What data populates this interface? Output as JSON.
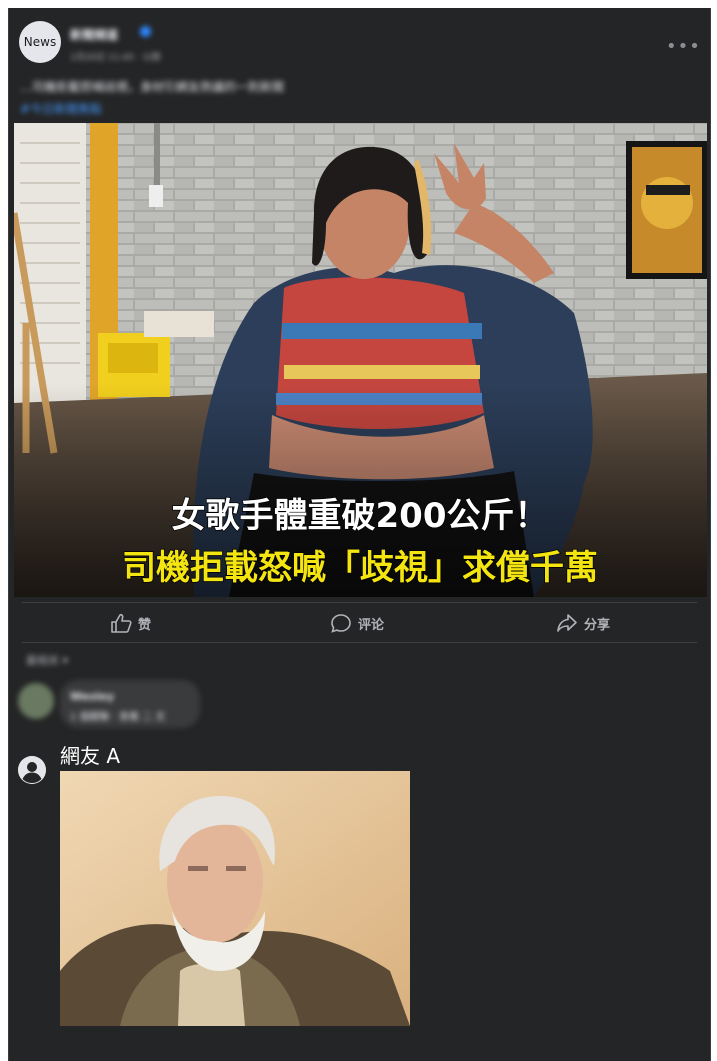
{
  "post": {
    "avatar_label": "News",
    "page_name": "新聞頻道",
    "time": "1月20日 11:45 · 公開",
    "text_line1": "…司機拒載怒喊歧視，身材引網友熱議的一則新聞",
    "hashtag": "#今日新聞焦點",
    "image": {
      "headline1": "女歌手體重破200公斤！",
      "headline2": "司機拒載怒喊「歧視」求償千萬",
      "accent_color": "#f4e511"
    }
  },
  "actions": {
    "like": "赞",
    "comment": "评论",
    "share": "分享"
  },
  "comments": {
    "sort_label": "最相关 ▾",
    "first": {
      "name": "Wesley",
      "text": "1 個關聯 · 查看 二 文"
    },
    "reply": {
      "user_name": "網友 A"
    }
  }
}
